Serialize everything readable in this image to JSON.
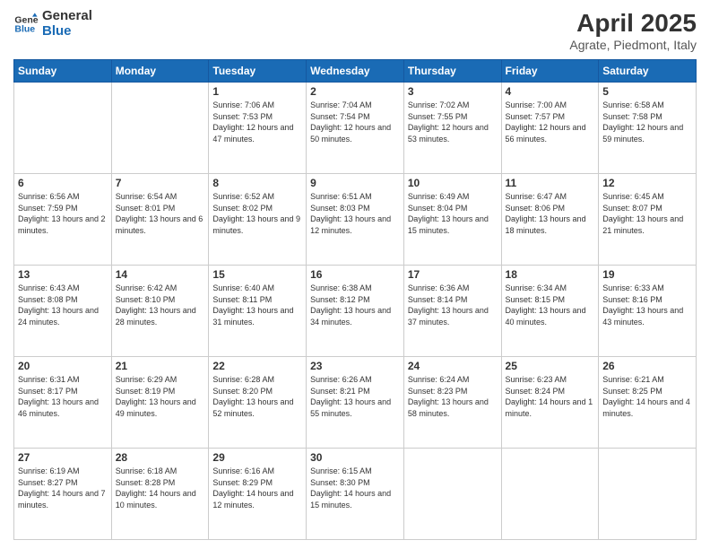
{
  "logo": {
    "line1": "General",
    "line2": "Blue"
  },
  "title": "April 2025",
  "subtitle": "Agrate, Piedmont, Italy",
  "days_header": [
    "Sunday",
    "Monday",
    "Tuesday",
    "Wednesday",
    "Thursday",
    "Friday",
    "Saturday"
  ],
  "weeks": [
    [
      {
        "day": "",
        "info": ""
      },
      {
        "day": "",
        "info": ""
      },
      {
        "day": "1",
        "info": "Sunrise: 7:06 AM\nSunset: 7:53 PM\nDaylight: 12 hours and 47 minutes."
      },
      {
        "day": "2",
        "info": "Sunrise: 7:04 AM\nSunset: 7:54 PM\nDaylight: 12 hours and 50 minutes."
      },
      {
        "day": "3",
        "info": "Sunrise: 7:02 AM\nSunset: 7:55 PM\nDaylight: 12 hours and 53 minutes."
      },
      {
        "day": "4",
        "info": "Sunrise: 7:00 AM\nSunset: 7:57 PM\nDaylight: 12 hours and 56 minutes."
      },
      {
        "day": "5",
        "info": "Sunrise: 6:58 AM\nSunset: 7:58 PM\nDaylight: 12 hours and 59 minutes."
      }
    ],
    [
      {
        "day": "6",
        "info": "Sunrise: 6:56 AM\nSunset: 7:59 PM\nDaylight: 13 hours and 2 minutes."
      },
      {
        "day": "7",
        "info": "Sunrise: 6:54 AM\nSunset: 8:01 PM\nDaylight: 13 hours and 6 minutes."
      },
      {
        "day": "8",
        "info": "Sunrise: 6:52 AM\nSunset: 8:02 PM\nDaylight: 13 hours and 9 minutes."
      },
      {
        "day": "9",
        "info": "Sunrise: 6:51 AM\nSunset: 8:03 PM\nDaylight: 13 hours and 12 minutes."
      },
      {
        "day": "10",
        "info": "Sunrise: 6:49 AM\nSunset: 8:04 PM\nDaylight: 13 hours and 15 minutes."
      },
      {
        "day": "11",
        "info": "Sunrise: 6:47 AM\nSunset: 8:06 PM\nDaylight: 13 hours and 18 minutes."
      },
      {
        "day": "12",
        "info": "Sunrise: 6:45 AM\nSunset: 8:07 PM\nDaylight: 13 hours and 21 minutes."
      }
    ],
    [
      {
        "day": "13",
        "info": "Sunrise: 6:43 AM\nSunset: 8:08 PM\nDaylight: 13 hours and 24 minutes."
      },
      {
        "day": "14",
        "info": "Sunrise: 6:42 AM\nSunset: 8:10 PM\nDaylight: 13 hours and 28 minutes."
      },
      {
        "day": "15",
        "info": "Sunrise: 6:40 AM\nSunset: 8:11 PM\nDaylight: 13 hours and 31 minutes."
      },
      {
        "day": "16",
        "info": "Sunrise: 6:38 AM\nSunset: 8:12 PM\nDaylight: 13 hours and 34 minutes."
      },
      {
        "day": "17",
        "info": "Sunrise: 6:36 AM\nSunset: 8:14 PM\nDaylight: 13 hours and 37 minutes."
      },
      {
        "day": "18",
        "info": "Sunrise: 6:34 AM\nSunset: 8:15 PM\nDaylight: 13 hours and 40 minutes."
      },
      {
        "day": "19",
        "info": "Sunrise: 6:33 AM\nSunset: 8:16 PM\nDaylight: 13 hours and 43 minutes."
      }
    ],
    [
      {
        "day": "20",
        "info": "Sunrise: 6:31 AM\nSunset: 8:17 PM\nDaylight: 13 hours and 46 minutes."
      },
      {
        "day": "21",
        "info": "Sunrise: 6:29 AM\nSunset: 8:19 PM\nDaylight: 13 hours and 49 minutes."
      },
      {
        "day": "22",
        "info": "Sunrise: 6:28 AM\nSunset: 8:20 PM\nDaylight: 13 hours and 52 minutes."
      },
      {
        "day": "23",
        "info": "Sunrise: 6:26 AM\nSunset: 8:21 PM\nDaylight: 13 hours and 55 minutes."
      },
      {
        "day": "24",
        "info": "Sunrise: 6:24 AM\nSunset: 8:23 PM\nDaylight: 13 hours and 58 minutes."
      },
      {
        "day": "25",
        "info": "Sunrise: 6:23 AM\nSunset: 8:24 PM\nDaylight: 14 hours and 1 minute."
      },
      {
        "day": "26",
        "info": "Sunrise: 6:21 AM\nSunset: 8:25 PM\nDaylight: 14 hours and 4 minutes."
      }
    ],
    [
      {
        "day": "27",
        "info": "Sunrise: 6:19 AM\nSunset: 8:27 PM\nDaylight: 14 hours and 7 minutes."
      },
      {
        "day": "28",
        "info": "Sunrise: 6:18 AM\nSunset: 8:28 PM\nDaylight: 14 hours and 10 minutes."
      },
      {
        "day": "29",
        "info": "Sunrise: 6:16 AM\nSunset: 8:29 PM\nDaylight: 14 hours and 12 minutes."
      },
      {
        "day": "30",
        "info": "Sunrise: 6:15 AM\nSunset: 8:30 PM\nDaylight: 14 hours and 15 minutes."
      },
      {
        "day": "",
        "info": ""
      },
      {
        "day": "",
        "info": ""
      },
      {
        "day": "",
        "info": ""
      }
    ]
  ]
}
